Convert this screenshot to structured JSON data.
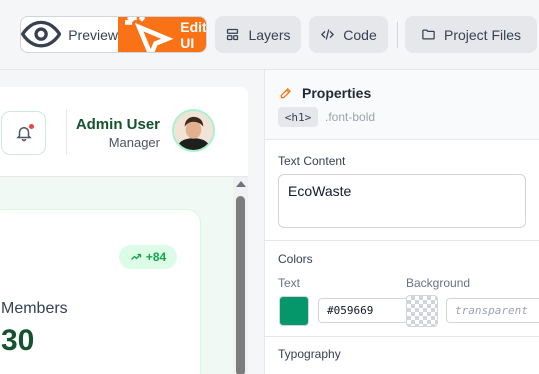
{
  "toolbar": {
    "preview_label": "Preview",
    "edit_label": "Edit UI",
    "layers_label": "Layers",
    "code_label": "Code",
    "project_files_label": "Project Files"
  },
  "header": {
    "user_name": "Admin User",
    "user_role": "Manager"
  },
  "stat": {
    "badge": "+84",
    "label": "Members",
    "value": "30"
  },
  "properties": {
    "title": "Properties",
    "tag": "<h1>",
    "class_name": ".font-bold",
    "text_content_label": "Text Content",
    "text_content_value": "EcoWaste",
    "colors_label": "Colors",
    "text_color_label": "Text",
    "text_color_value": "#059669",
    "background_label": "Background",
    "background_placeholder": "transparent",
    "typography_label": "Typography"
  },
  "colors": {
    "accent": "#f97316",
    "brand_green": "#059669",
    "name_green": "#14532d"
  }
}
